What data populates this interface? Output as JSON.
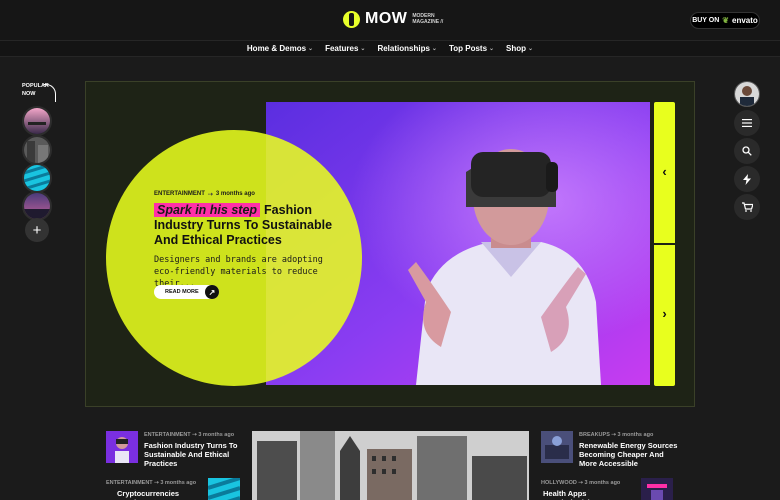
{
  "header": {
    "logo_text": "MOW",
    "logo_sub1": "MODERN",
    "logo_sub2": "MAGAZINE //",
    "buy_label": "BUY ON",
    "buy_brand": "envato"
  },
  "nav": [
    {
      "label": "Home & Demos"
    },
    {
      "label": "Features"
    },
    {
      "label": "Relationships"
    },
    {
      "label": "Top Posts"
    },
    {
      "label": "Shop"
    }
  ],
  "left_rail": {
    "popular_label": "POPULAR NOW",
    "add_icon": "plus-icon"
  },
  "right_rail": {
    "icons": [
      "menu-icon",
      "search-icon",
      "flash-icon",
      "cart-icon"
    ]
  },
  "hero": {
    "category": "ENTERTAINMENT",
    "time": "3 months ago",
    "highlight": "Spark in his step",
    "title": "Fashion Industry Turns To Sustainable And Ethical Practices",
    "excerpt": "Designers and brands are adopting eco-friendly materials to reduce their...",
    "read_more": "READ MORE"
  },
  "news": [
    {
      "category": "ENTERTAINMENT",
      "time": "3 months ago",
      "title": "Fashion Industry Turns To Sustainable And Ethical Practices"
    },
    {
      "category": "ENTERTAINMENT",
      "time": "3 months ago",
      "title": "Cryptocurrencies Surging"
    },
    {
      "category": "BREAKUPS",
      "time": "3 months ago",
      "title": "Renewable Energy Sources Becoming Cheaper And More Accessible"
    },
    {
      "category": "HOLLYWOOD",
      "time": "3 months ago",
      "title": "Health Apps Revolutionizing"
    }
  ],
  "colors": {
    "accent": "#e8ff1e",
    "highlight": "#ff2fa8",
    "background": "#1b1b1b"
  }
}
